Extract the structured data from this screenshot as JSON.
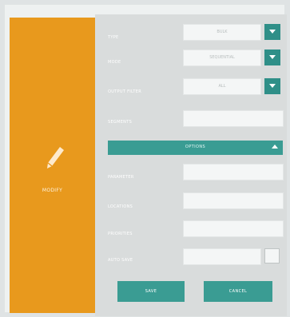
{
  "sidebar": {
    "label": "MODIFY",
    "icon": "pencil-icon"
  },
  "fields": [
    {
      "label": "TYPE",
      "value": "BULK",
      "kind": "select"
    },
    {
      "label": "MODE",
      "value": "SEQUENTIAL",
      "kind": "select"
    },
    {
      "label": "OUTPUT FILTER",
      "value": "ALL",
      "kind": "select"
    },
    {
      "label": "SEGMENTS",
      "value": "",
      "kind": "text"
    }
  ],
  "section": {
    "title": "OPTIONS"
  },
  "options": [
    {
      "label": "PARAMETER",
      "value": ""
    },
    {
      "label": "LOCATIONS",
      "value": ""
    },
    {
      "label": "PRIORITIES",
      "value": ""
    },
    {
      "label": "AUTO SAVE",
      "kind": "checkbox",
      "checked": false
    }
  ],
  "buttons": {
    "save": "SAVE",
    "cancel": "CANCEL"
  },
  "colors": {
    "accent": "#e8991d",
    "teal": "#3a9c93"
  }
}
